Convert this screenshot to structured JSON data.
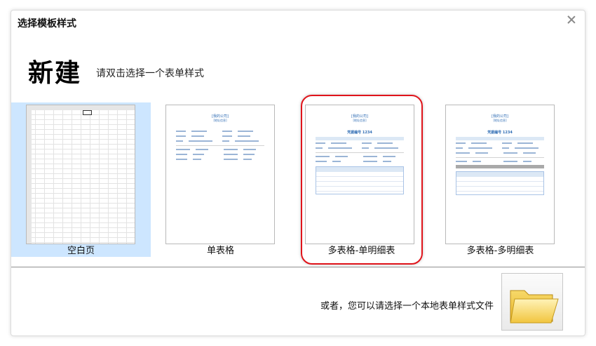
{
  "dialog": {
    "title": "选择模板样式",
    "heading": "新建",
    "subheading": "请双击选择一个表单样式"
  },
  "templates": [
    {
      "label": "空白页",
      "selected": true
    },
    {
      "label": "单表格",
      "selected": false
    },
    {
      "label": "多表格-单明细表",
      "selected": false,
      "highlighted": true
    },
    {
      "label": "多表格-多明细表",
      "selected": false
    }
  ],
  "footer": {
    "text": "或者，您可以请选择一个本地表单样式文件",
    "folder_icon": "folder-open-icon"
  },
  "colors": {
    "selection": "#cde6ff",
    "highlight": "#e0141b",
    "accent": "#2d6bb3"
  }
}
